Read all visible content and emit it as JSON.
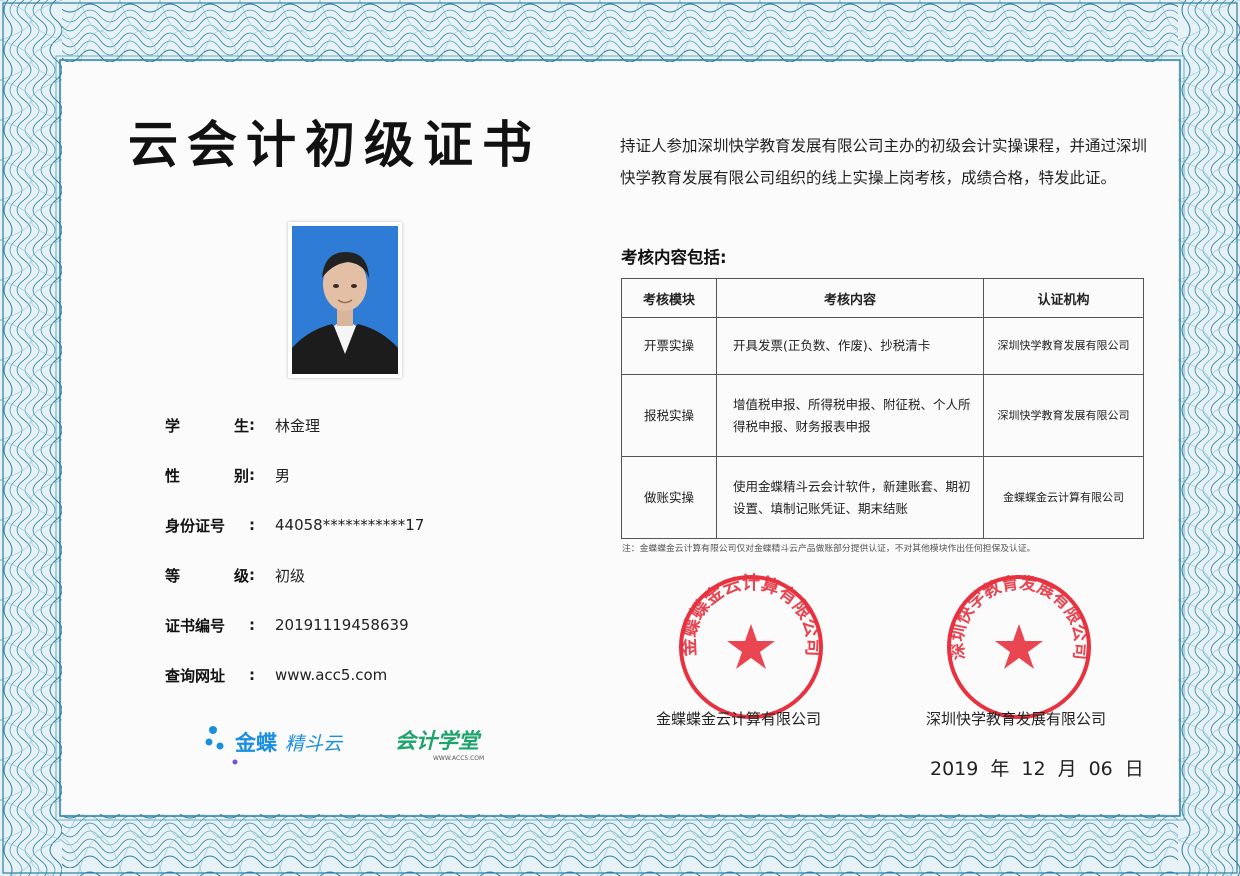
{
  "certificate": {
    "title": "云会计初级证书"
  },
  "student": {
    "rows": [
      {
        "label": "学生",
        "value": "林金理"
      },
      {
        "label": "性别",
        "value": "男"
      },
      {
        "label": "身份证号",
        "value": "44058***********17"
      },
      {
        "label": "等级",
        "value": "初级"
      },
      {
        "label": "证书编号",
        "value": "20191119458639"
      },
      {
        "label": "查询网址",
        "value": "www.acc5.com"
      }
    ],
    "colon": ":"
  },
  "logos": {
    "kingdee": "金蝶",
    "kingdee_sub": "精斗云",
    "school": "会计学堂",
    "school_url": "WWW.ACC5.COM"
  },
  "intro": {
    "text": "持证人参加深圳快学教育发展有限公司主办的初级会计实操课程，并通过深圳快学教育发展有限公司组织的线上实操上岗考核，成绩合格，特发此证。"
  },
  "exam": {
    "heading": "考核内容包括:",
    "headers": [
      "考核模块",
      "考核内容",
      "认证机构"
    ],
    "rows": [
      {
        "module": "开票实操",
        "content": "开具发票(正负数、作废)、抄税清卡",
        "org": "深圳快学教育发展有限公司"
      },
      {
        "module": "报税实操",
        "content": "增值税申报、所得税申报、附征税、个人所得税申报、财务报表申报",
        "org": "深圳快学教育发展有限公司"
      },
      {
        "module": "做账实操",
        "content": "使用金蝶精斗云会计软件，新建账套、期初设置、填制记账凭证、期末结账",
        "org": "金蝶蝶金云计算有限公司"
      }
    ],
    "note": "注：金蝶蝶金云计算有限公司仅对金蝶精斗云产品做账部分提供认证，不对其他模块作出任何担保及认证。"
  },
  "seals": [
    {
      "text": "金蝶蝶金云计算有限公司",
      "color": "#e8323f"
    },
    {
      "text": "深圳快学教育发展有限公司",
      "color": "#e8323f"
    }
  ],
  "signatures": {
    "org1": "金蝶蝶金云计算有限公司",
    "org2": "深圳快学教育发展有限公司"
  },
  "date": {
    "year": "2019",
    "year_unit": "年",
    "month": "12",
    "month_unit": "月",
    "day": "06",
    "day_unit": "日"
  },
  "colors": {
    "border": "#2f7f9e",
    "border_light": "#8cc3d6",
    "seal_red": "#e8323f",
    "photo_bg": "#2f7cd6",
    "kingdee_blue": "#1a8fe0",
    "school_green": "#1ea36b"
  }
}
